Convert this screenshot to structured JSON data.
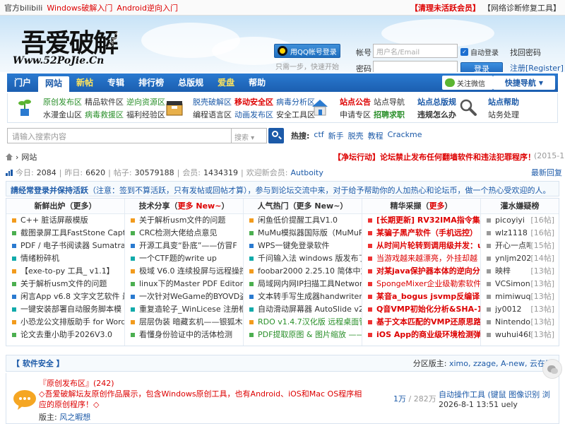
{
  "topbar": {
    "left": [
      {
        "label": "官方bilibili",
        "color": "black"
      },
      {
        "label": "Windows破解入门",
        "color": "red"
      },
      {
        "label": "Android逆向入门",
        "color": "red"
      }
    ],
    "right": [
      {
        "label": "【清理未活跃会员】",
        "color": "red"
      },
      {
        "label": "【网络诊断修复工具】",
        "color": "black"
      }
    ]
  },
  "header": {
    "logo_main": "吾爱破解",
    "logo_url": "Www.52PoJie.Cn",
    "logo_crack": "CRACK",
    "qq_login": "用QQ帐号登录",
    "qq_hint": "只需一步，快速开始",
    "account_label": "帐号",
    "account_placeholder": "用户名/Email",
    "password_label": "密码",
    "auto_login": "自动登录",
    "login_button": "登录",
    "find_password": "找回密码",
    "register": "注册[Register]"
  },
  "nav": {
    "items": [
      {
        "label": "门户",
        "style": "normal"
      },
      {
        "label": "网站",
        "style": "active"
      },
      {
        "label": "新帖",
        "style": "yellow"
      },
      {
        "label": "专辑",
        "style": "normal"
      },
      {
        "label": "排行榜",
        "style": "normal"
      },
      {
        "label": "总版规",
        "style": "normal"
      },
      {
        "label": "爱盘",
        "style": "yellow"
      },
      {
        "label": "帮助",
        "style": "normal"
      }
    ],
    "wechat": "关注微信",
    "quick_nav": "快捷导航"
  },
  "sub_links": {
    "group1_row1": [
      {
        "label": "原创发布区",
        "style": "green"
      },
      {
        "label": "精品软件区",
        "style": "black"
      },
      {
        "label": "逆向资源区",
        "style": "green"
      }
    ],
    "group1_row2": [
      {
        "label": "水漫金山区",
        "style": "black"
      },
      {
        "label": "病毒救援区",
        "style": "green"
      },
      {
        "label": "福利经验区",
        "style": "black"
      }
    ],
    "group2_row1": [
      {
        "label": "脱壳破解区",
        "style": "blue"
      },
      {
        "label": "移动安全区",
        "style": "redb"
      },
      {
        "label": "病毒分析区",
        "style": "blue"
      }
    ],
    "group2_row2": [
      {
        "label": "编程语言区",
        "style": "black"
      },
      {
        "label": "动画发布区",
        "style": "blue"
      },
      {
        "label": "安全工具区",
        "style": "black"
      }
    ],
    "group3_row1": [
      {
        "label": "站点公告",
        "style": "redb"
      },
      {
        "label": "站点导航",
        "style": "black"
      }
    ],
    "group3_row2": [
      {
        "label": "申请专区",
        "style": "black"
      },
      {
        "label": "招聘求职",
        "style": "greenb"
      }
    ],
    "group4_row1": [
      {
        "label": "站点总版规",
        "style": "blueb"
      }
    ],
    "group4_row2": [
      {
        "label": "违规怎么办",
        "style": "bold"
      }
    ],
    "group5_row1": [
      {
        "label": "站点帮助",
        "style": "blueb"
      }
    ],
    "group5_row2": [
      {
        "label": "站务处理",
        "style": "black"
      }
    ]
  },
  "search": {
    "placeholder": "请输入搜索内容",
    "select": "搜索 ▾",
    "hot_label": "热搜:",
    "hot_words": [
      "ctf",
      "新手",
      "脱壳",
      "教程",
      "Crackme"
    ]
  },
  "breadcrumb": {
    "current": "网站",
    "notice": "【净坛行动】论坛禁止发布任何翻墙软件和违法犯罪程序！",
    "notice_date": "(2015-12-"
  },
  "stats": {
    "today_label": "今日:",
    "today": "2084",
    "yesterday_label": "昨日:",
    "yesterday": "6620",
    "posts_label": "帖子:",
    "posts": "30579188",
    "members_label": "会员:",
    "members": "1434319",
    "welcome_label": "欢迎新会员:",
    "newest": "Autboity",
    "latest_reply": "最新回复"
  },
  "notice_bar": {
    "bold": "請经常登录并保持活跃",
    "text": "（注意：签到不算活跃，只有发帖或回帖才算），参与到论坛交流中来，对于给予帮助你的人加热心和论坛币，做一个热心受欢迎的人。"
  },
  "lists": [
    {
      "head": "新鲜出炉（更多）",
      "head_hl": "",
      "bullet": "orange",
      "items": [
        "C++ 脏话屏蔽模版",
        "截图录屏工具FastStone Captu",
        "PDF / 电子书阅读器 SumatraP",
        "情绪粉碎机",
        "【exe-to-py 工具_ v1.1】",
        "关于解析usm文件的问题",
        "闲言App v6.8 文字文艺软件 最",
        "一键安装部署自动服务脚本模",
        "小恐龙公文排版助手 for Word/",
        "论文去重小助手2026V3.0"
      ]
    },
    {
      "head": "技术分享（",
      "head_hl": "更多 New~",
      "head_tail": "）",
      "bullet": "orange",
      "items": [
        "关于解析usm文件的问题",
        "CRC检测大佬给点意见",
        "开源工具变“卧底”——仿冒F",
        "一个CTF题的write up",
        "极域 V6.0 连续投屏与远程操控",
        "linux下的Master PDF Editor 5.",
        "一次针对WeGame的BYOVD盗",
        "重复造轮子_WinLicese 注册框",
        "层层伪装 暗藏玄机——银狐木",
        "看懂身份验证中的活体检测"
      ]
    },
    {
      "head": "人气热门（更多 New~）",
      "head_hl": "",
      "bullet": "green",
      "items": [
        "闲鱼低价提醒工具V1.0",
        "MuMu模拟器国际版（MuMuPl",
        "WPS一键免登录软件",
        "千问输入法 windows 版发布了",
        "foobar2000 2.25.10 简体中文",
        "局域网内网IP扫描工具Networ",
        "文本转手写生成器handwriter",
        "自动滑动屏幕器 AutoSlide v2.",
        "RDO v1.4.7汉化版 远程桌面管",
        "PDF提取原图 & 图片缩放 ——"
      ]
    },
    {
      "head": "精华采撷（",
      "head_hl": "更多",
      "head_tail": "）",
      "bullet": "red",
      "items": [
        "[长期更新] RV32IMA指令集模",
        "某骗子黑产软件（手机远控）",
        "从时间片轮转到调用级并发：u",
        "当游戏越来越漂亮，外挂却越",
        "对某java保护器本体的逆向分",
        "SpongeMixer企业级勒索软件",
        "某音a_bogus jsvmp反编译",
        "Q音VMP初始化分析&SHA-1算",
        "基于文本匹配的VMP还原思路",
        "iOS App的商业级环境检测弹"
      ]
    },
    {
      "head": "灌水嫌疑榜",
      "head_hl": "",
      "bullet": "gray",
      "items": [
        {
          "name": "picoyiyi",
          "count": "[16帖]"
        },
        {
          "name": "wlz1118",
          "count": "[16帖]"
        },
        {
          "name": "开心一点吧",
          "count": "[15帖]"
        },
        {
          "name": "ynljm2020",
          "count": "[14帖]"
        },
        {
          "name": "映梓",
          "count": "[13帖]"
        },
        {
          "name": "VCSimon",
          "count": "[13帖]"
        },
        {
          "name": "mimiwuqi",
          "count": "[13帖]"
        },
        {
          "name": "jy0012",
          "count": "[13帖]"
        },
        {
          "name": "Nintendo",
          "count": "[13帖]"
        },
        {
          "name": "wuhui468",
          "count": "[13帖]"
        }
      ]
    }
  ],
  "section": {
    "title": "【 软件安全 】",
    "mods_label": "分区版主:",
    "mods": "ximo, zzage, A-new, 云在天"
  },
  "forum": {
    "title": "『原创发布区』",
    "count": "(242)",
    "desc": "◇吾爱破解坛友原创作品展示，包含Windows原创工具，也有Android、iOS和Mac OS程序相应的原创程序！◇",
    "mod_label": "版主:",
    "mod": "风之暇想",
    "threads": "1万",
    "posts": "/ 282万",
    "last_title": "自动操作工具 (键鼠 图像识别 浏 ...",
    "last_time": "2026-8-1 13:51 uely"
  }
}
